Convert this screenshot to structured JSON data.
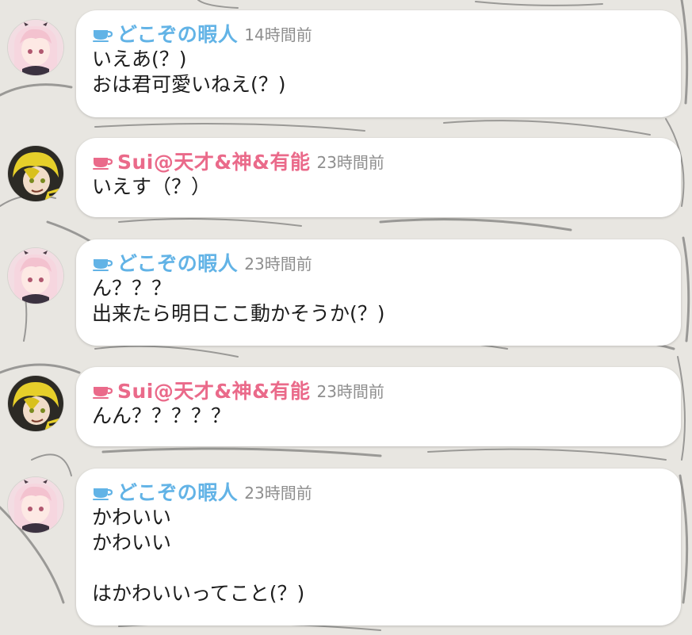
{
  "colors": {
    "blue_user": "#62b3e6",
    "pink_user": "#ea6a8a",
    "timestamp": "#8e8e8e",
    "bubble": "#ffffff"
  },
  "messages": [
    {
      "author": "どこぞの暇人",
      "author_color": "#62b3e6",
      "cup_icon": "teacup-icon",
      "timestamp": "14時間前",
      "avatar": "pink-hair-avatar",
      "lines": [
        "いえあ(？)",
        "おは君可愛いねえ(？)"
      ]
    },
    {
      "author": "Sui@天才&神&有能",
      "author_color": "#ea6a8a",
      "cup_icon": "teacup-icon",
      "timestamp": "23時間前",
      "avatar": "yellow-hair-avatar",
      "lines": [
        "いえす（？）"
      ]
    },
    {
      "author": "どこぞの暇人",
      "author_color": "#62b3e6",
      "cup_icon": "teacup-icon",
      "timestamp": "23時間前",
      "avatar": "pink-hair-avatar",
      "lines": [
        "ん？？？",
        "出来たら明日ここ動かそうか(？)"
      ]
    },
    {
      "author": "Sui@天才&神&有能",
      "author_color": "#ea6a8a",
      "cup_icon": "teacup-icon",
      "timestamp": "23時間前",
      "avatar": "yellow-hair-avatar",
      "lines": [
        "んん？？？？？"
      ]
    },
    {
      "author": "どこぞの暇人",
      "author_color": "#62b3e6",
      "cup_icon": "teacup-icon",
      "timestamp": "23時間前",
      "avatar": "pink-hair-avatar",
      "lines": [
        "かわいい",
        "かわいい",
        "",
        "はかわいいってこと(？)"
      ]
    }
  ]
}
